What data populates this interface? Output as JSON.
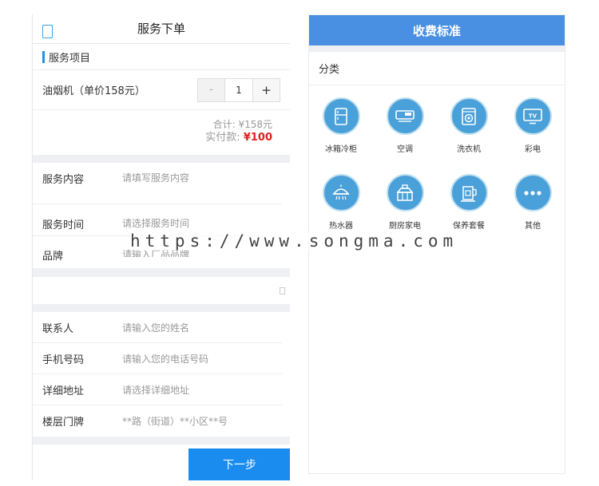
{
  "order": {
    "title": "服务下单",
    "section_title": "服务项目",
    "product": {
      "name": "油烟机（单价158元）",
      "qty": "1",
      "minus": "-",
      "plus": "+"
    },
    "subtotal": "合计: ¥158元",
    "paid_label": "实付款: ",
    "paid_value": "¥100",
    "fields": {
      "content": {
        "label": "服务内容",
        "placeholder": "请填写服务内容"
      },
      "time": {
        "label": "服务时间",
        "placeholder": "请选择服务时间"
      },
      "brand": {
        "label": "品牌",
        "placeholder": "请输入厂品品牌"
      }
    },
    "contact": [
      {
        "label": "联系人",
        "placeholder": "请输入您的姓名"
      },
      {
        "label": "手机号码",
        "placeholder": "请输入您的电话号码"
      },
      {
        "label": "详细地址",
        "placeholder": "请选择详细地址"
      },
      {
        "label": "楼层门牌",
        "placeholder": "**路（街道）**小区**号"
      }
    ],
    "next_button": "下一步"
  },
  "pricing": {
    "title": "收费标准",
    "category_title": "分类",
    "categories": [
      {
        "label": "冰箱冷柜",
        "icon": "fridge-icon"
      },
      {
        "label": "空调",
        "icon": "air-conditioner-icon"
      },
      {
        "label": "洗衣机",
        "icon": "washing-machine-icon"
      },
      {
        "label": "彩电",
        "icon": "tv-icon"
      },
      {
        "label": "热水器",
        "icon": "water-heater-icon"
      },
      {
        "label": "厨房家电",
        "icon": "kitchen-appliance-icon"
      },
      {
        "label": "保养套餐",
        "icon": "maintenance-package-icon"
      },
      {
        "label": "其他",
        "icon": "more-icon"
      }
    ],
    "tv_text": "TV"
  },
  "watermark": "https://www.songma.com",
  "colors": {
    "accent": "#1a8cf0",
    "header_blue": "#4a90e2",
    "icon_blue": "#4aa0d8",
    "price_red": "#e02020"
  }
}
